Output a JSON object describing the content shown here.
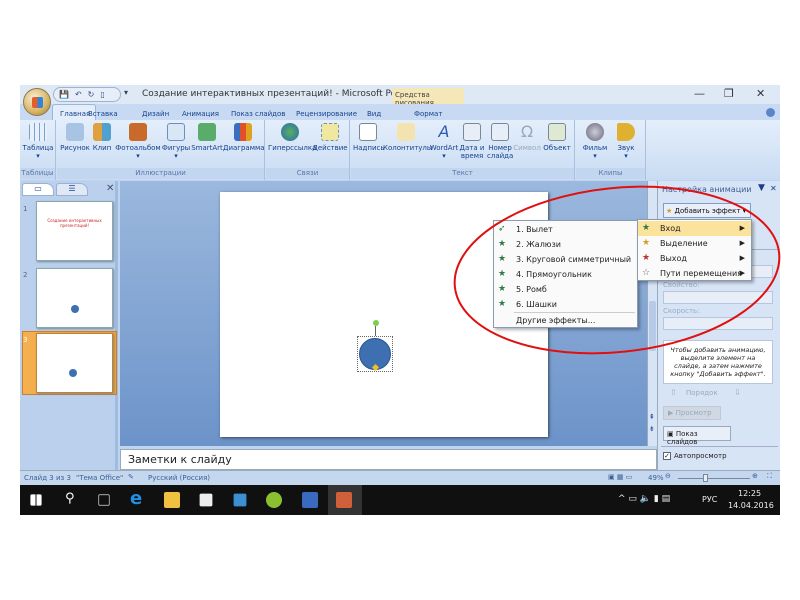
{
  "window": {
    "title": "Создание интерактивных презентаций! - Microsoft PowerPoint",
    "context_tab": "Средства рисования",
    "minimize": "—",
    "restore": "❐",
    "close": "✕"
  },
  "tabs": [
    "Главная",
    "Вставка",
    "Дизайн",
    "Анимация",
    "Показ слайдов",
    "Рецензирование",
    "Вид",
    "Формат"
  ],
  "active_tab": "Вставка",
  "ribbon": {
    "groups": [
      {
        "label": "Таблицы",
        "buttons": [
          "Таблица"
        ]
      },
      {
        "label": "Иллюстрации",
        "buttons": [
          "Рисунок",
          "Клип",
          "Фотоальбом",
          "Фигуры",
          "SmartArt",
          "Диаграмма"
        ]
      },
      {
        "label": "Связи",
        "buttons": [
          "Гиперссылка",
          "Действие"
        ]
      },
      {
        "label": "Текст",
        "buttons": [
          "Надпись",
          "Колонтитулы",
          "WordArt",
          "Дата и время",
          "Номер слайда",
          "Символ",
          "Объект"
        ]
      },
      {
        "label": "Клипы мультимедиа",
        "buttons": [
          "Фильм",
          "Звук"
        ]
      }
    ]
  },
  "slides_pane": {
    "close": "✕",
    "slides": [
      {
        "number": "1",
        "title": "Создание интерактивных презентаций!"
      },
      {
        "number": "2"
      },
      {
        "number": "3"
      }
    ]
  },
  "notes_placeholder": "Заметки к слайду",
  "effects_menu": {
    "items": [
      "1. Вылет",
      "2. Жалюзи",
      "3. Круговой симметричный",
      "4. Прямоугольник",
      "5. Ромб",
      "6. Шашки"
    ],
    "more": "Другие эффекты..."
  },
  "add_effect_menu": {
    "items": [
      "Вход",
      "Выделение",
      "Выход",
      "Пути перемещения"
    ]
  },
  "animation_pane": {
    "title": "Настройка анимации",
    "add_effect": "Добавить эффект",
    "property_label": "Свойство:",
    "speed_label": "Скорость:",
    "hint": "Чтобы добавить анимацию, выделите элемент на слайде, а затем нажмите кнопку \"Добавить эффект\".",
    "order": "Порядок",
    "preview": "Просмотр",
    "slideshow": "Показ слайдов",
    "autopreview": "Автопросмотр",
    "autopreview_checked": true
  },
  "status": {
    "slide": "Слайд 3 из 3",
    "theme": "\"Тема Office\"",
    "language": "Русский (Россия)",
    "zoom": "49%"
  },
  "taskbar": {
    "lang": "РУС",
    "time": "12:25",
    "date": "14.04.2016"
  },
  "colors": {
    "accent": "#c8daf3",
    "highlight": "#fbe39b",
    "annotation": "#e01010",
    "shape": "#3e6fb0"
  }
}
